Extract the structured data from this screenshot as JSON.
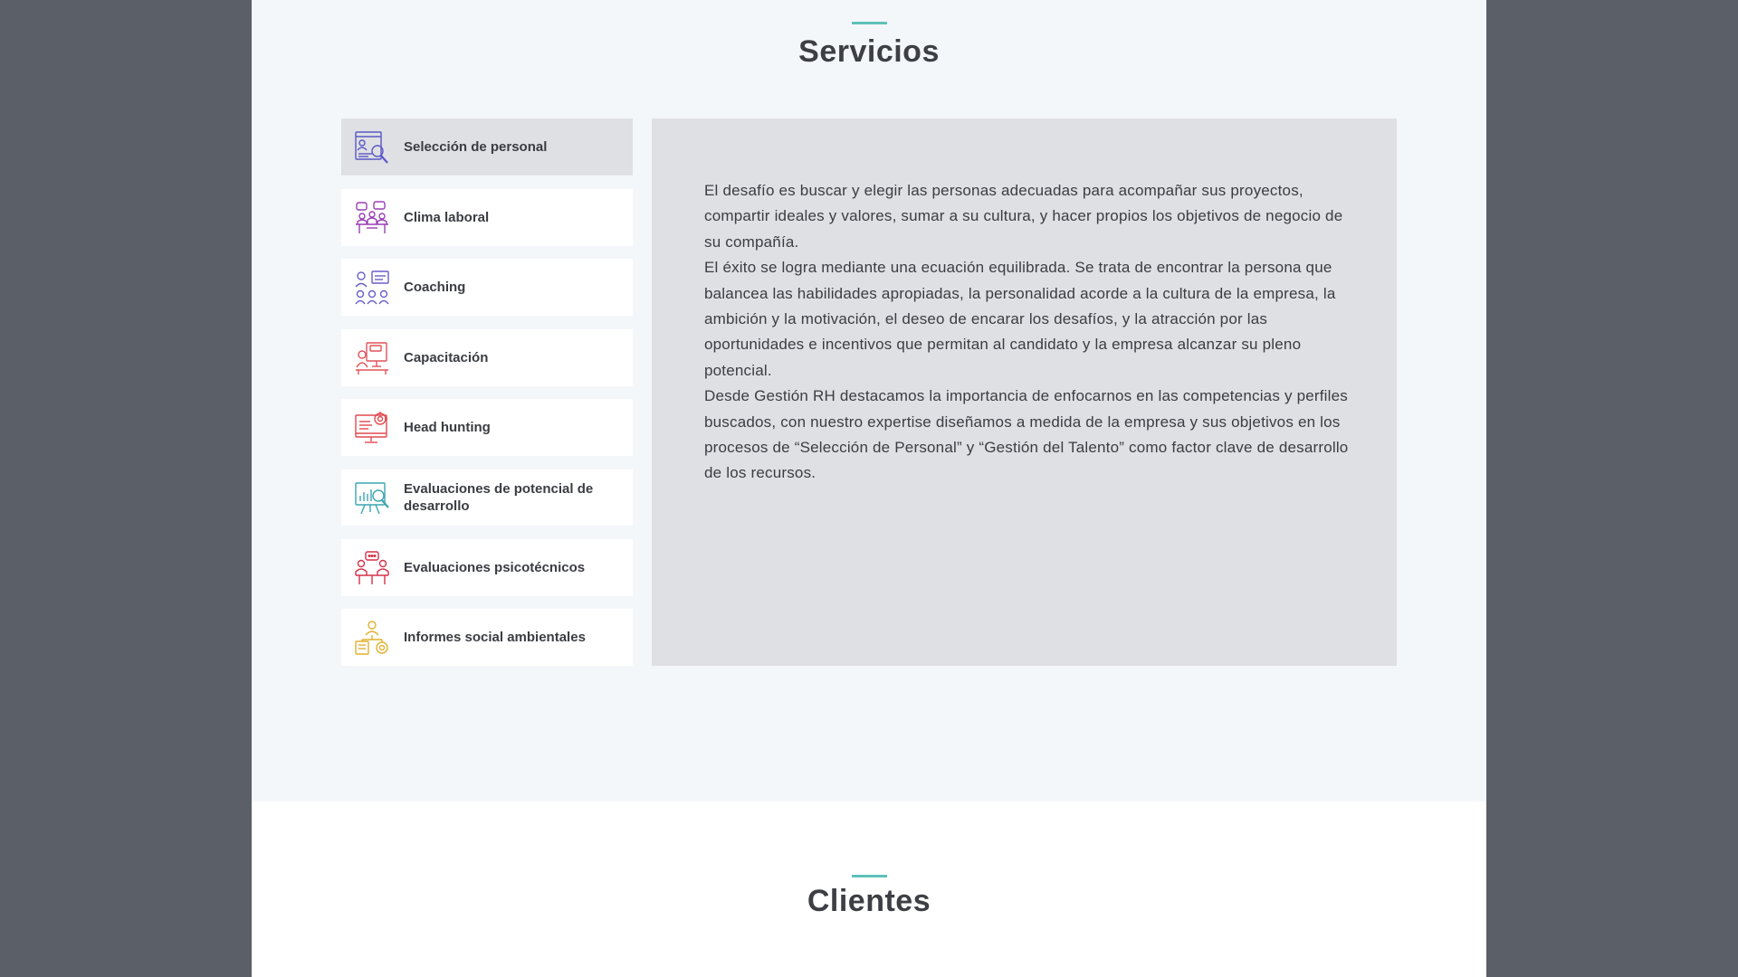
{
  "services": {
    "title": "Servicios",
    "tabs": [
      {
        "label": "Selección de personal",
        "icon": "recruitment-icon",
        "color": "#5a58c6",
        "active": true
      },
      {
        "label": "Clima laboral",
        "icon": "work-climate-icon",
        "color": "#9b3fb5",
        "active": false
      },
      {
        "label": "Coaching",
        "icon": "coaching-icon",
        "color": "#6a5fc9",
        "active": false
      },
      {
        "label": "Capacitación",
        "icon": "training-icon",
        "color": "#e0525a",
        "active": false
      },
      {
        "label": "Head hunting",
        "icon": "head-hunting-icon",
        "color": "#e04a4f",
        "active": false
      },
      {
        "label": "Evaluaciones de potencial de desarrollo",
        "icon": "development-evaluation-icon",
        "color": "#3aa6b0",
        "active": false
      },
      {
        "label": "Evaluaciones psicotécnicos",
        "icon": "psychotechnical-icon",
        "color": "#d3334a",
        "active": false
      },
      {
        "label": "Informes social ambientales",
        "icon": "social-report-icon",
        "color": "#e2b12f",
        "active": false
      }
    ],
    "content": {
      "paragraphs": [
        "El desafío es buscar y elegir las personas adecuadas para acompañar sus proyectos, compartir ideales y valores, sumar a su cultura, y hacer propios los objetivos de negocio de su compañía.",
        "El éxito se logra mediante una ecuación equilibrada. Se trata de encontrar la persona que balancea las habilidades apropiadas, la personalidad acorde a la cultura de la empresa, la ambición y la motivación, el deseo de encarar los desafíos, y la atracción por las oportunidades e incentivos que permitan al candidato y la empresa alcanzar su pleno potencial.",
        "Desde Gestión RH destacamos la importancia de enfocarnos en las competencias y perfiles buscados, con nuestro expertise  diseñamos a medida de la empresa y sus objetivos en los procesos de  “Selección de Personal” y “Gestión del Talento” como factor clave de desarrollo de los recursos."
      ]
    }
  },
  "clients": {
    "title": "Clientes"
  },
  "colors": {
    "accent": "#5fc1b9",
    "background": "#5b5f68",
    "page": "#f4f7fa",
    "active_tab": "#dfe0e3"
  }
}
